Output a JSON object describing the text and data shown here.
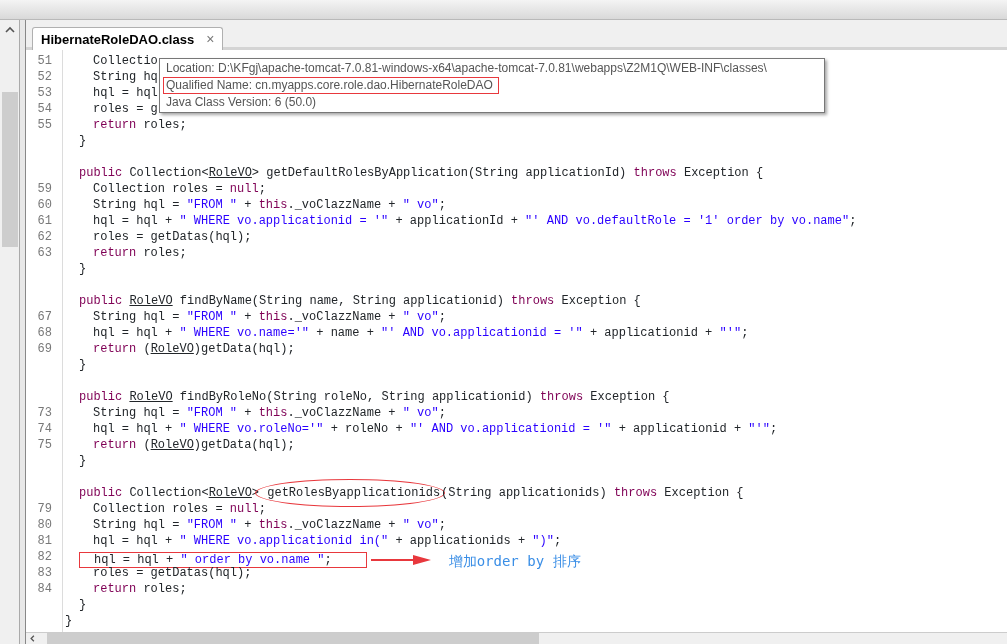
{
  "tab": {
    "label": "HibernateRoleDAO.class",
    "close": "×",
    "selected": true
  },
  "tooltip": [
    {
      "text": "Location: D:\\KFgj\\apache-tomcat-7.0.81-windows-x64\\apache-tomcat-7.0.81\\webapps\\Z2M1Q\\WEB-INF\\classes\\",
      "highlighted": false
    },
    {
      "text": "Qualified Name: cn.myapps.core.role.dao.HibernateRoleDAO",
      "highlighted": true
    },
    {
      "text": "Java Class Version: 6 (50.0)",
      "highlighted": false
    }
  ],
  "code_lines": [
    {
      "number": "51",
      "kind": "statement",
      "tokens": [
        {
          "text": "Collectio",
          "kind": "plain"
        }
      ]
    },
    {
      "number": "52",
      "kind": "statement",
      "tokens": [
        {
          "text": "String hq",
          "kind": "plain"
        }
      ]
    },
    {
      "number": "53",
      "kind": "statement",
      "tokens": [
        {
          "text": "hql = hql",
          "kind": "plain"
        }
      ]
    },
    {
      "number": "54",
      "kind": "statement",
      "tokens": [
        {
          "text": "roles = g",
          "kind": "plain"
        }
      ]
    },
    {
      "number": "55",
      "kind": "statement",
      "tokens": [
        {
          "text": "return",
          "kind": "keyword"
        },
        {
          "text": " roles;",
          "kind": "plain"
        }
      ]
    },
    {
      "kind": "member",
      "tokens": [
        {
          "text": "}",
          "kind": "plain"
        }
      ]
    },
    {
      "kind": "blank"
    },
    {
      "kind": "member",
      "tokens": [
        {
          "text": "public",
          "kind": "keyword"
        },
        {
          "text": " Collection<",
          "kind": "plain"
        },
        {
          "text": "RoleVO",
          "kind": "type"
        },
        {
          "text": "> getDefaultRolesByApplication(String applicationId) ",
          "kind": "plain"
        },
        {
          "text": "throws",
          "kind": "keyword"
        },
        {
          "text": " Exception {",
          "kind": "plain"
        }
      ]
    },
    {
      "number": "59",
      "kind": "statement",
      "tokens": [
        {
          "text": "Collection roles = ",
          "kind": "plain"
        },
        {
          "text": "null",
          "kind": "keyword"
        },
        {
          "text": ";",
          "kind": "plain"
        }
      ]
    },
    {
      "number": "60",
      "kind": "statement",
      "tokens": [
        {
          "text": "String hql = ",
          "kind": "plain"
        },
        {
          "text": "\"FROM \"",
          "kind": "string"
        },
        {
          "text": " + ",
          "kind": "plain"
        },
        {
          "text": "this",
          "kind": "keyword"
        },
        {
          "text": "._voClazzName + ",
          "kind": "plain"
        },
        {
          "text": "\" vo\"",
          "kind": "string"
        },
        {
          "text": ";",
          "kind": "plain"
        }
      ]
    },
    {
      "number": "61",
      "kind": "statement",
      "tokens": [
        {
          "text": "hql = hql + ",
          "kind": "plain"
        },
        {
          "text": "\" WHERE vo.applicationid = '\"",
          "kind": "string"
        },
        {
          "text": " + applicationId + ",
          "kind": "plain"
        },
        {
          "text": "\"' AND vo.defaultRole = '1' order by vo.name\"",
          "kind": "string"
        },
        {
          "text": ";",
          "kind": "plain"
        }
      ]
    },
    {
      "number": "62",
      "kind": "statement",
      "tokens": [
        {
          "text": "roles = getDatas(hql);",
          "kind": "plain"
        }
      ]
    },
    {
      "number": "63",
      "kind": "statement",
      "tokens": [
        {
          "text": "return",
          "kind": "keyword"
        },
        {
          "text": " roles;",
          "kind": "plain"
        }
      ]
    },
    {
      "kind": "member",
      "tokens": [
        {
          "text": "}",
          "kind": "plain"
        }
      ]
    },
    {
      "kind": "blank"
    },
    {
      "kind": "member",
      "tokens": [
        {
          "text": "public ",
          "kind": "keyword"
        },
        {
          "text": "RoleVO",
          "kind": "type"
        },
        {
          "text": " findByName(String name, String applicationid) ",
          "kind": "plain"
        },
        {
          "text": "throws",
          "kind": "keyword"
        },
        {
          "text": " Exception {",
          "kind": "plain"
        }
      ]
    },
    {
      "number": "67",
      "kind": "statement",
      "tokens": [
        {
          "text": "String hql = ",
          "kind": "plain"
        },
        {
          "text": "\"FROM \"",
          "kind": "string"
        },
        {
          "text": " + ",
          "kind": "plain"
        },
        {
          "text": "this",
          "kind": "keyword"
        },
        {
          "text": "._voClazzName + ",
          "kind": "plain"
        },
        {
          "text": "\" vo\"",
          "kind": "string"
        },
        {
          "text": ";",
          "kind": "plain"
        }
      ]
    },
    {
      "number": "68",
      "kind": "statement",
      "tokens": [
        {
          "text": "hql = hql + ",
          "kind": "plain"
        },
        {
          "text": "\" WHERE vo.name='\"",
          "kind": "string"
        },
        {
          "text": " + name + ",
          "kind": "plain"
        },
        {
          "text": "\"' AND vo.applicationid = '\"",
          "kind": "string"
        },
        {
          "text": " + applicationid + ",
          "kind": "plain"
        },
        {
          "text": "\"'\"",
          "kind": "string"
        },
        {
          "text": ";",
          "kind": "plain"
        }
      ]
    },
    {
      "number": "69",
      "kind": "statement",
      "tokens": [
        {
          "text": "return",
          "kind": "keyword"
        },
        {
          "text": " (",
          "kind": "plain"
        },
        {
          "text": "RoleVO",
          "kind": "type"
        },
        {
          "text": ")getData(hql);",
          "kind": "plain"
        }
      ]
    },
    {
      "kind": "member",
      "tokens": [
        {
          "text": "}",
          "kind": "plain"
        }
      ]
    },
    {
      "kind": "blank"
    },
    {
      "kind": "member",
      "tokens": [
        {
          "text": "public ",
          "kind": "keyword"
        },
        {
          "text": "RoleVO",
          "kind": "type"
        },
        {
          "text": " findByRoleNo(String roleNo, String applicationid) ",
          "kind": "plain"
        },
        {
          "text": "throws",
          "kind": "keyword"
        },
        {
          "text": " Exception {",
          "kind": "plain"
        }
      ]
    },
    {
      "number": "73",
      "kind": "statement",
      "tokens": [
        {
          "text": "String hql = ",
          "kind": "plain"
        },
        {
          "text": "\"FROM \"",
          "kind": "string"
        },
        {
          "text": " + ",
          "kind": "plain"
        },
        {
          "text": "this",
          "kind": "keyword"
        },
        {
          "text": "._voClazzName + ",
          "kind": "plain"
        },
        {
          "text": "\" vo\"",
          "kind": "string"
        },
        {
          "text": ";",
          "kind": "plain"
        }
      ]
    },
    {
      "number": "74",
      "kind": "statement",
      "tokens": [
        {
          "text": "hql = hql + ",
          "kind": "plain"
        },
        {
          "text": "\" WHERE vo.roleNo='\"",
          "kind": "string"
        },
        {
          "text": " + roleNo + ",
          "kind": "plain"
        },
        {
          "text": "\"' AND vo.applicationid = '\"",
          "kind": "string"
        },
        {
          "text": " + applicationid + ",
          "kind": "plain"
        },
        {
          "text": "\"'\"",
          "kind": "string"
        },
        {
          "text": ";",
          "kind": "plain"
        }
      ]
    },
    {
      "number": "75",
      "kind": "statement",
      "tokens": [
        {
          "text": "return",
          "kind": "keyword"
        },
        {
          "text": " (",
          "kind": "plain"
        },
        {
          "text": "RoleVO",
          "kind": "type"
        },
        {
          "text": ")getData(hql);",
          "kind": "plain"
        }
      ]
    },
    {
      "kind": "member",
      "tokens": [
        {
          "text": "}",
          "kind": "plain"
        }
      ]
    },
    {
      "kind": "blank"
    },
    {
      "kind": "member",
      "tokens": [
        {
          "text": "public",
          "kind": "keyword"
        },
        {
          "text": " Collection<",
          "kind": "plain"
        },
        {
          "text": "RoleVO",
          "kind": "type"
        },
        {
          "text": ">",
          "kind": "plain"
        },
        {
          "text": " getRolesByapplicationids",
          "kind": "circled"
        },
        {
          "text": "(String applicationids) ",
          "kind": "plain"
        },
        {
          "text": "throws",
          "kind": "keyword"
        },
        {
          "text": " Exception {",
          "kind": "plain"
        }
      ]
    },
    {
      "number": "79",
      "kind": "statement",
      "tokens": [
        {
          "text": "Collection roles = ",
          "kind": "plain"
        },
        {
          "text": "null",
          "kind": "keyword"
        },
        {
          "text": ";",
          "kind": "plain"
        }
      ]
    },
    {
      "number": "80",
      "kind": "statement",
      "tokens": [
        {
          "text": "String hql = ",
          "kind": "plain"
        },
        {
          "text": "\"FROM \"",
          "kind": "string"
        },
        {
          "text": " + ",
          "kind": "plain"
        },
        {
          "text": "this",
          "kind": "keyword"
        },
        {
          "text": "._voClazzName + ",
          "kind": "plain"
        },
        {
          "text": "\" vo\"",
          "kind": "string"
        },
        {
          "text": ";",
          "kind": "plain"
        }
      ]
    },
    {
      "number": "81",
      "kind": "statement",
      "tokens": [
        {
          "text": "hql = hql + ",
          "kind": "plain"
        },
        {
          "text": "\" WHERE vo.applicationid in(\"",
          "kind": "string"
        },
        {
          "text": " + applicationids + ",
          "kind": "plain"
        },
        {
          "text": "\")\"",
          "kind": "string"
        },
        {
          "text": ";",
          "kind": "plain"
        }
      ]
    },
    {
      "number": "82",
      "kind": "statement",
      "boxed": true,
      "note": "增加order by 排序",
      "tokens": [
        {
          "text": "hql = hql + ",
          "kind": "plain"
        },
        {
          "text": "\" order by vo.name \"",
          "kind": "string"
        },
        {
          "text": ";",
          "kind": "plain"
        }
      ]
    },
    {
      "number": "83",
      "kind": "statement",
      "tokens": [
        {
          "text": "roles = getDatas(hql);",
          "kind": "plain"
        }
      ]
    },
    {
      "number": "84",
      "kind": "statement",
      "tokens": [
        {
          "text": "return",
          "kind": "keyword"
        },
        {
          "text": " roles;",
          "kind": "plain"
        }
      ]
    },
    {
      "kind": "member",
      "tokens": [
        {
          "text": "}",
          "kind": "plain"
        }
      ]
    },
    {
      "kind": "class",
      "tokens": [
        {
          "text": "}",
          "kind": "plain"
        }
      ]
    }
  ]
}
